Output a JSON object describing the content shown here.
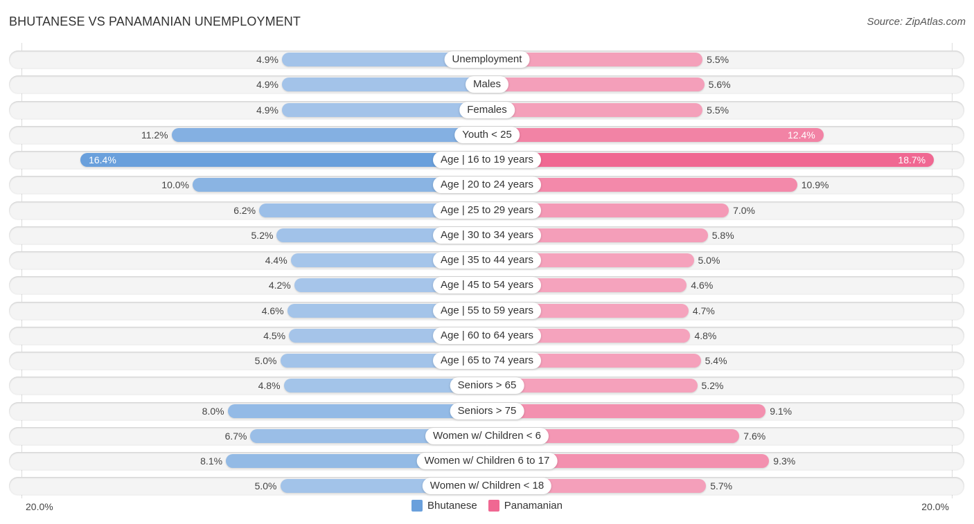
{
  "header": {
    "title": "BHUTANESE VS PANAMANIAN UNEMPLOYMENT",
    "source": "Source: ZipAtlas.com"
  },
  "colors": {
    "bhutanese": "#6aa0dc",
    "bhutanese_light": "#a7c6ea",
    "panamanian": "#f06892",
    "panamanian_light": "#f5a6bf"
  },
  "chart_data": {
    "type": "bar",
    "orientation": "horizontal-diverging",
    "title": "BHUTANESE VS PANAMANIAN UNEMPLOYMENT",
    "xlabel": "",
    "ylabel": "",
    "xlim": [
      -20,
      20
    ],
    "axis_ticks": {
      "left": "20.0%",
      "right": "20.0%"
    },
    "legend": {
      "position": "bottom-center",
      "entries": [
        "Bhutanese",
        "Panamanian"
      ]
    },
    "categories": [
      "Unemployment",
      "Males",
      "Females",
      "Youth < 25",
      "Age | 16 to 19 years",
      "Age | 20 to 24 years",
      "Age | 25 to 29 years",
      "Age | 30 to 34 years",
      "Age | 35 to 44 years",
      "Age | 45 to 54 years",
      "Age | 55 to 59 years",
      "Age | 60 to 64 years",
      "Age | 65 to 74 years",
      "Seniors > 65",
      "Seniors > 75",
      "Women w/ Children < 6",
      "Women w/ Children 6 to 17",
      "Women w/ Children < 18"
    ],
    "series": [
      {
        "name": "Bhutanese",
        "side": "left",
        "values": [
          4.9,
          4.9,
          4.9,
          11.2,
          16.4,
          10.0,
          6.2,
          5.2,
          4.4,
          4.2,
          4.6,
          4.5,
          5.0,
          4.8,
          8.0,
          6.7,
          8.1,
          5.0
        ],
        "labels": [
          "4.9%",
          "4.9%",
          "4.9%",
          "11.2%",
          "16.4%",
          "10.0%",
          "6.2%",
          "5.2%",
          "4.4%",
          "4.2%",
          "4.6%",
          "4.5%",
          "5.0%",
          "4.8%",
          "8.0%",
          "6.7%",
          "8.1%",
          "5.0%"
        ]
      },
      {
        "name": "Panamanian",
        "side": "right",
        "values": [
          5.5,
          5.6,
          5.5,
          12.4,
          18.7,
          10.9,
          7.0,
          5.8,
          5.0,
          4.6,
          4.7,
          4.8,
          5.4,
          5.2,
          9.1,
          7.6,
          9.3,
          5.7
        ],
        "labels": [
          "5.5%",
          "5.6%",
          "5.5%",
          "12.4%",
          "18.7%",
          "10.9%",
          "7.0%",
          "5.8%",
          "5.0%",
          "4.6%",
          "4.7%",
          "4.8%",
          "5.4%",
          "5.2%",
          "9.1%",
          "7.6%",
          "9.3%",
          "5.7%"
        ]
      }
    ]
  }
}
